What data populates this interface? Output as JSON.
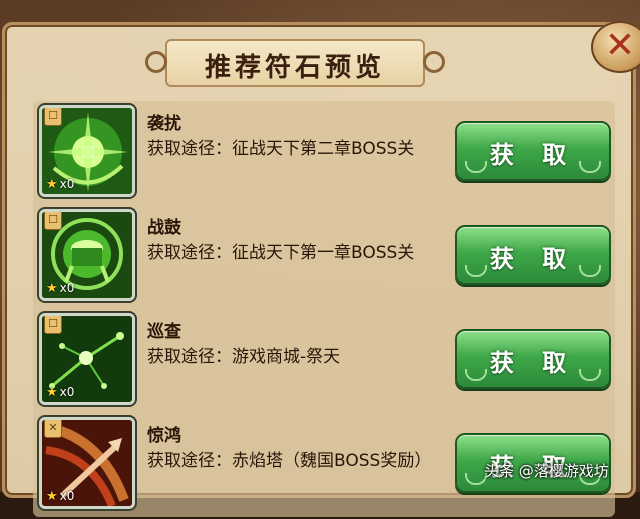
{
  "dialog": {
    "title": "推荐符石预览",
    "close_icon": "close-x-icon"
  },
  "items": [
    {
      "name": "袭扰",
      "route": "获取途径：征战天下第二章BOSS关",
      "count": "x0",
      "badge": "☐",
      "button": "获 取",
      "icon": "green-burst-art"
    },
    {
      "name": "战鼓",
      "route": "获取途径：征战天下第一章BOSS关",
      "count": "x0",
      "badge": "☐",
      "button": "获 取",
      "icon": "green-drum-art"
    },
    {
      "name": "巡查",
      "route": "获取途径：游戏商城-祭天",
      "count": "x0",
      "badge": "☐",
      "button": "获 取",
      "icon": "green-star-art"
    },
    {
      "name": "惊鸿",
      "route": "获取途径：赤焰塔（魏国BOSS奖励）",
      "count": "x0",
      "badge": "✕",
      "button": "获 取",
      "icon": "red-slash-art"
    }
  ],
  "watermark": "头条 @落樱游戏坊",
  "colors": {
    "button_green": "#3fa84a",
    "panel": "#eedebc",
    "red_icon": "#5a1e10"
  }
}
